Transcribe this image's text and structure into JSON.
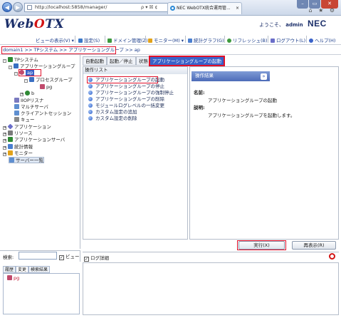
{
  "browser": {
    "address": "http://localhost:5858/manager/",
    "address_controls": "ρ ▾ ☒ ¢",
    "tab_title": "NEC WebOTX統合運用管...",
    "toolbar_icons": "⌂ ★ ⚙"
  },
  "app": {
    "logo_prefix": "Web",
    "logo_o": "O",
    "logo_suffix": "TX",
    "welcome_prefix": "ようこそ、",
    "user": "admin",
    "brand": "NEC"
  },
  "menu": {
    "view": "ビューの表示(V)",
    "settings": "設定(S)",
    "domain": "ドメイン管理(Z)",
    "monitor": "モニター(M)",
    "graph": "統計グラフ(G)",
    "refresh": "リフレッシュ(B)",
    "logout": "ログアウト(L)",
    "help": "ヘルプ(H)"
  },
  "breadcrumb": "domain1 >> TPシステム >> アプリケーショングループ >> ap",
  "tree": {
    "tp_system": "TPシステム",
    "app_group": "アプリケーショングループ",
    "ap": "ap",
    "process_group": "プロセスグループ",
    "pg": "pg",
    "b": "b",
    "iiop": "IIOPリスナ",
    "multi": "マルチサーバ",
    "client_session": "クライアントセッション",
    "queue": "キュー",
    "application": "アプリケーション",
    "resource": "リソース",
    "app_server": "アプリケーションサーバ",
    "stats": "統計情報",
    "monitor": "モニター",
    "server_list": "サーバー一覧"
  },
  "search": {
    "label": "検索:",
    "view_label": "ビュー",
    "view_checked": true
  },
  "bottom_tabs": [
    "履歴",
    "変更",
    "検索結果"
  ],
  "bottom_item": "pg",
  "main_tabs": [
    "自動起動",
    "起動／停止",
    "状態",
    "アプリケーショングループの起動"
  ],
  "ops": {
    "header": "操作リスト",
    "items": [
      "アプリケーショングループの起動",
      "アプリケーショングループの停止",
      "アプリケーショングループの強制停止",
      "アプリケーショングループの削除",
      "モジュールログレベルの一括変更",
      "カスタム設定の追加",
      "カスタム設定の削除"
    ]
  },
  "result": {
    "header": "操作結果",
    "name_label": "名前:",
    "name_value": "アプリケーショングループの起動",
    "desc_label": "説明:",
    "desc_value": "アプリケーショングループを起動します。"
  },
  "buttons": {
    "execute": "実行(X)",
    "redisplay": "再表示(R)"
  },
  "log": {
    "label": "ログ詳細",
    "checked": true
  },
  "colors": {
    "accent": "#3a63c9",
    "highlight": "#e0102a",
    "brand": "#1c2f6a"
  }
}
